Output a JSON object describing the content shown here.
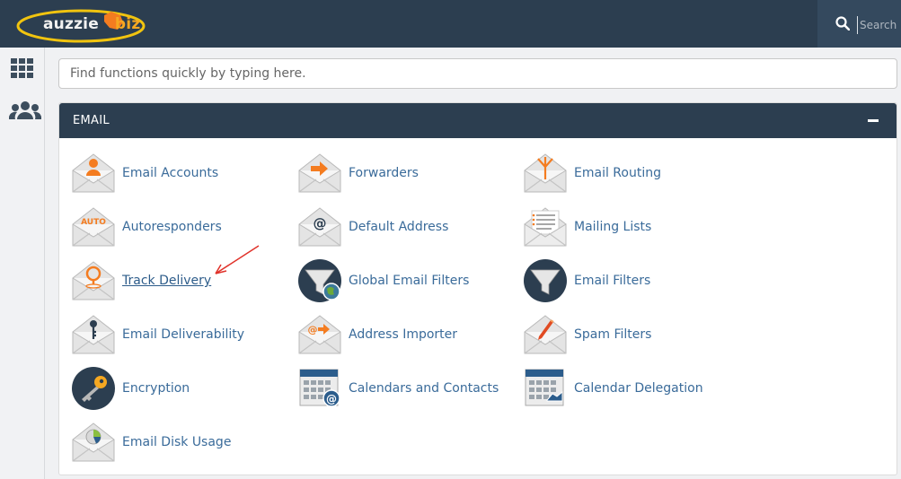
{
  "brand": {
    "part1": "auzzie",
    "part2": "biz"
  },
  "search": {
    "placeholder": "Search ("
  },
  "quickfind": {
    "placeholder": "Find functions quickly by typing here."
  },
  "section": {
    "title": "EMAIL"
  },
  "items": [
    {
      "label": "Email Accounts",
      "icon": "email-accounts-icon"
    },
    {
      "label": "Forwarders",
      "icon": "forwarders-icon"
    },
    {
      "label": "Email Routing",
      "icon": "email-routing-icon"
    },
    {
      "label": "Autoresponders",
      "icon": "autoresponders-icon",
      "badge": "AUTO"
    },
    {
      "label": "Default Address",
      "icon": "default-address-icon"
    },
    {
      "label": "Mailing Lists",
      "icon": "mailing-lists-icon"
    },
    {
      "label": "Track Delivery",
      "icon": "track-delivery-icon"
    },
    {
      "label": "Global Email Filters",
      "icon": "global-email-filters-icon"
    },
    {
      "label": "Email Filters",
      "icon": "email-filters-icon"
    },
    {
      "label": "Email Deliverability",
      "icon": "email-deliverability-icon"
    },
    {
      "label": "Address Importer",
      "icon": "address-importer-icon"
    },
    {
      "label": "Spam Filters",
      "icon": "spam-filters-icon"
    },
    {
      "label": "Encryption",
      "icon": "encryption-icon"
    },
    {
      "label": "Calendars and Contacts",
      "icon": "calendars-contacts-icon"
    },
    {
      "label": "Calendar Delegation",
      "icon": "calendar-delegation-icon"
    },
    {
      "label": "Email Disk Usage",
      "icon": "email-disk-usage-icon"
    }
  ],
  "colors": {
    "header": "#2c3e50",
    "link": "#3a6b9a",
    "accent": "#f47c20",
    "annotation_arrow": "#e0322a"
  }
}
